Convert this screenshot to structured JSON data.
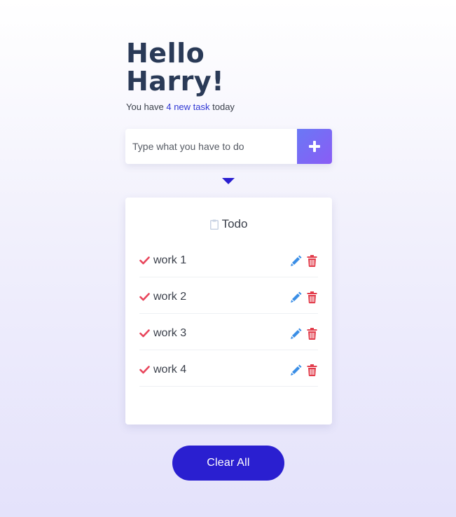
{
  "greeting": {
    "line1": "Hello",
    "line2": "Harry!"
  },
  "subtitle": {
    "prefix": "You have ",
    "count_text": "4 new task",
    "suffix": " today"
  },
  "input": {
    "placeholder": "Type what you have to do",
    "value": ""
  },
  "add_button": {
    "icon": "plus-icon"
  },
  "card": {
    "title": "Todo",
    "icon": "clipboard-icon"
  },
  "todos": [
    {
      "text": "work 1"
    },
    {
      "text": "work 2"
    },
    {
      "text": "work 3"
    },
    {
      "text": "work 4"
    }
  ],
  "clear_button": {
    "label": "Clear All"
  },
  "colors": {
    "accent": "#2a1fd0",
    "check": "#e8455b",
    "edit": "#3a8ee6",
    "delete": "#e23c4b",
    "heading": "#2a3a57"
  }
}
